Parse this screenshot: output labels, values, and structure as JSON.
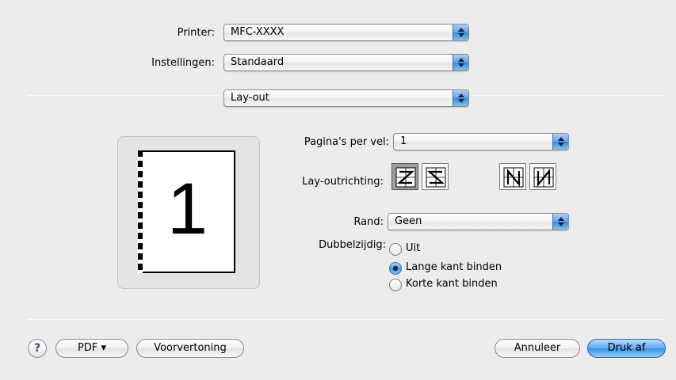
{
  "printer": {
    "label": "Printer:",
    "value": "MFC-XXXX"
  },
  "settings": {
    "label": "Instellingen:",
    "value": "Standaard"
  },
  "panel": {
    "value": "Lay-out"
  },
  "preview": {
    "page_number": "1"
  },
  "layout": {
    "pages_per_sheet": {
      "label": "Pagina's per vel:",
      "value": "1"
    },
    "direction": {
      "label": "Lay-outrichting:",
      "options": [
        "z-right-down",
        "reverse-s-left-down",
        "n-down-right",
        "reverse-n-down-left"
      ],
      "selected": 0
    },
    "border": {
      "label": "Rand:",
      "value": "Geen"
    },
    "duplex": {
      "label": "Dubbelzijdig:",
      "options": [
        "Uit",
        "Lange kant binden",
        "Korte kant binden"
      ],
      "selected": 1
    }
  },
  "footer": {
    "help_label": "?",
    "pdf_label": "PDF ▾",
    "preview_label": "Voorvertoning",
    "cancel_label": "Annuleer",
    "print_label": "Druk af"
  },
  "colors": {
    "accent": "#3c8fe4",
    "window": "#ececec"
  },
  "icons": [
    "popup-arrows-icon",
    "z-order-icon",
    "s-order-icon",
    "n-order-icon",
    "reverse-n-order-icon",
    "help-icon"
  ]
}
